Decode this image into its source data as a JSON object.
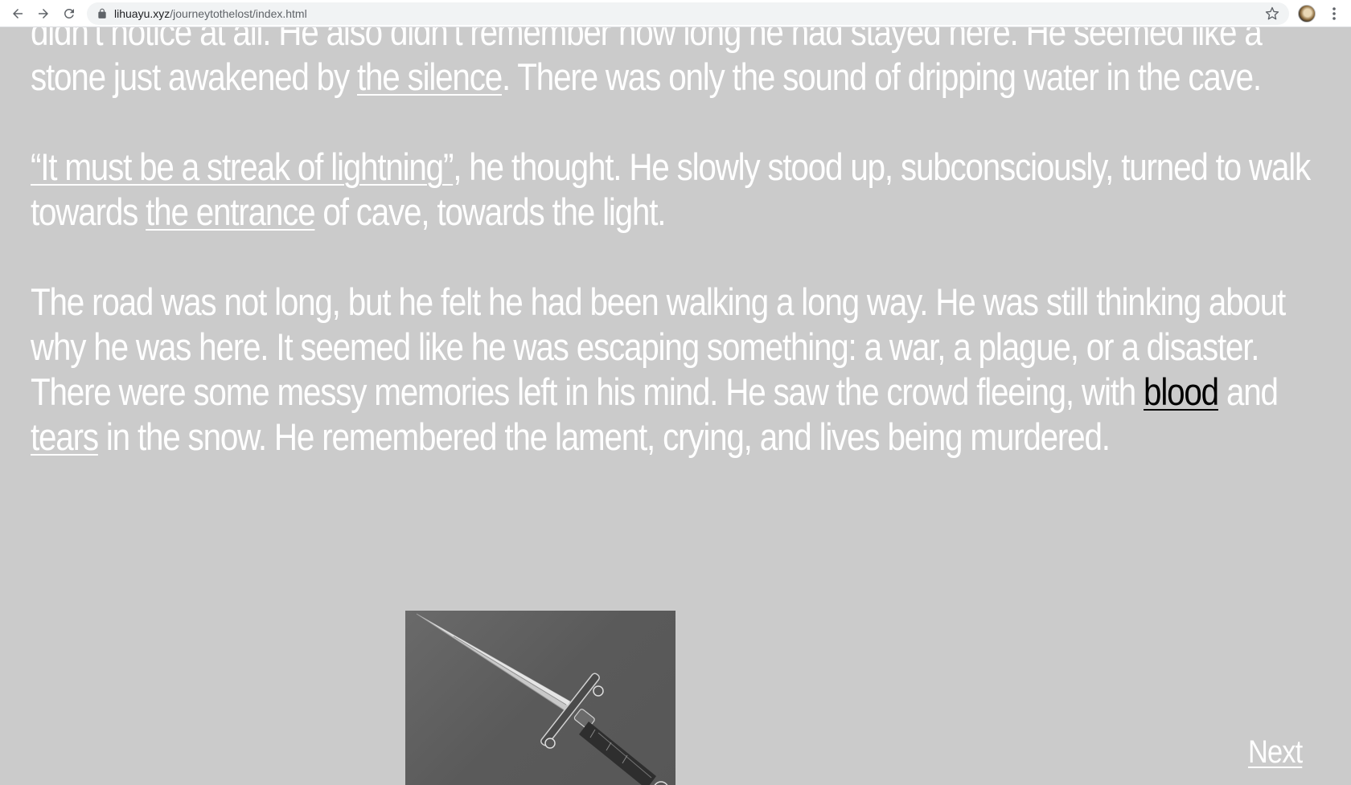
{
  "browser": {
    "url_host": "lihuayu.xyz",
    "url_path": "/journeytothelost/index.html",
    "icons": {
      "back": "arrow-left-icon",
      "forward": "arrow-right-icon",
      "reload": "reload-icon",
      "lock": "lock-icon",
      "bookmark": "star-icon",
      "profile": "avatar",
      "menu": "kebab-menu-icon"
    }
  },
  "story": {
    "p1": {
      "t1": "didn’t notice at all. He also didn’t remember how long he had stayed here. He seemed like a stone just awakened by ",
      "link1": "the silence",
      "t2": ". There was only the sound of dripping water in the cave."
    },
    "p2": {
      "link1": "“It must be a streak of lightning”",
      "t1": ", he thought. He slowly stood up, subconsciously, turned to walk towards ",
      "link2": "the entrance",
      "t2": " of cave, towards the light."
    },
    "p3": {
      "t1": "The road was not long, but he felt he had been walking a long way. He was still thinking about why he was here. It seemed like he was escaping something: a war, a plague, or a disaster. There were some messy memories left in his mind. He saw the crowd fleeing, with ",
      "link1": "blood",
      "t2": " and ",
      "link2": "tears",
      "t3": " in the snow. He remembered the lament, crying, and lives being murdered."
    }
  },
  "image": {
    "subject": "dagger"
  },
  "next_label": "Next",
  "colors": {
    "page_background": "#cbcbcb",
    "text": "#ffffff",
    "visited_link": "#000000"
  }
}
